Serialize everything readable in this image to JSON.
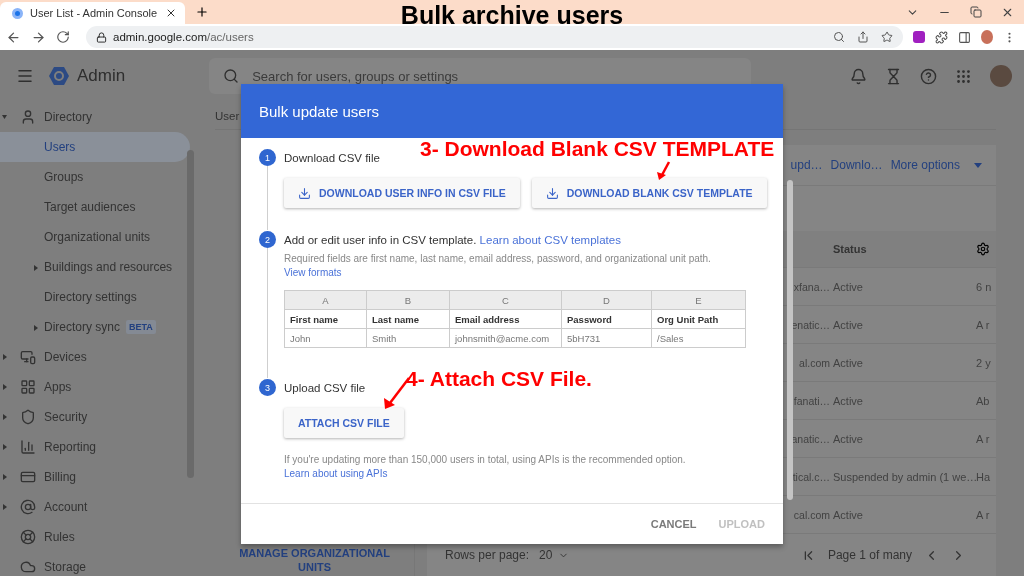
{
  "annotation_title": "Bulk archive users",
  "browser": {
    "tab_title": "User List - Admin Console",
    "url_host": "admin.google.com",
    "url_path": "/ac/users"
  },
  "header": {
    "app_name": "Admin",
    "search": {
      "placeholder": "Search for users, groups or settings"
    }
  },
  "sidebar": {
    "items": [
      {
        "label": "Directory",
        "kind": "folder",
        "expanded": true,
        "selected": false,
        "children": [
          {
            "label": "Users",
            "kind": "leaf",
            "selected": true
          },
          {
            "label": "Groups",
            "kind": "leaf",
            "selected": false
          },
          {
            "label": "Target audiences",
            "kind": "leaf",
            "selected": false
          },
          {
            "label": "Organizational units",
            "kind": "leaf",
            "selected": false
          },
          {
            "label": "Buildings and resources",
            "kind": "folder",
            "expanded": false,
            "selected": false
          },
          {
            "label": "Directory settings",
            "kind": "leaf",
            "selected": false
          },
          {
            "label": "Directory sync",
            "kind": "folder",
            "expanded": false,
            "selected": false,
            "badge": "BETA"
          }
        ]
      },
      {
        "label": "Devices",
        "kind": "folder",
        "expanded": false,
        "selected": false
      },
      {
        "label": "Apps",
        "kind": "folder",
        "expanded": false,
        "selected": false
      },
      {
        "label": "Security",
        "kind": "folder",
        "expanded": false,
        "selected": false
      },
      {
        "label": "Reporting",
        "kind": "folder",
        "expanded": false,
        "selected": false
      },
      {
        "label": "Billing",
        "kind": "folder",
        "expanded": false,
        "selected": false
      },
      {
        "label": "Account",
        "kind": "folder",
        "expanded": false,
        "selected": false
      },
      {
        "label": "Rules",
        "kind": "leaf",
        "selected": false
      },
      {
        "label": "Storage",
        "kind": "leaf",
        "selected": false
      }
    ]
  },
  "main": {
    "tab_label": "User",
    "toolbar": [
      {
        "label": "upd…",
        "kind": "link"
      },
      {
        "label": "Downlo…",
        "kind": "link"
      },
      {
        "label": "More options",
        "kind": "menu"
      }
    ],
    "table": {
      "columns": [
        "Status"
      ],
      "rows": [
        {
          "column_1": "xfana…",
          "status": "Active",
          "column_3": "6 n"
        },
        {
          "column_1": "enatic…",
          "status": "Active",
          "column_3": "A r"
        },
        {
          "column_1": "al.com",
          "status": "Active",
          "column_3": "2 y"
        },
        {
          "column_1": "fanati…",
          "status": "Active",
          "column_3": "Ab"
        },
        {
          "column_1": "anatic…",
          "status": "Active",
          "column_3": "A r"
        },
        {
          "column_1": "tical.c…",
          "status": "Suspended by admin (1 we…",
          "column_3": "Ha"
        },
        {
          "column_1": "cal.com",
          "status": "Active",
          "column_3": "A r"
        }
      ]
    },
    "manage_button": "MANAGE ORGANIZATIONAL UNITS",
    "pager": {
      "rows_label": "Rows per page:",
      "rows_value": "20",
      "page_label": "Page 1 of many"
    }
  },
  "dialog": {
    "title": "Bulk update users",
    "steps": [
      {
        "number": "1",
        "title": "Download CSV file",
        "buttons": [
          "DOWNLOAD USER INFO IN CSV FILE",
          "DOWNLOAD BLANK CSV TEMPLATE"
        ]
      },
      {
        "number": "2",
        "title": "Add or edit user info in CSV template.",
        "link": "Learn about CSV templates",
        "note": "Required fields are first name, last name, email address, password, and organizational unit path.",
        "note_link": "View formats",
        "template": {
          "letters": [
            "A",
            "B",
            "C",
            "D",
            "E"
          ],
          "header": [
            "First name",
            "Last name",
            "Email address",
            "Password",
            "Org Unit Path"
          ],
          "sample": [
            "John",
            "Smith",
            "johnsmith@acme.com",
            "5bH731",
            "/Sales"
          ]
        }
      },
      {
        "number": "3",
        "title": "Upload CSV file",
        "buttons": [
          "ATTACH CSV FILE"
        ],
        "note": "If you're updating more than 150,000 users in total, using APIs is the recommended option.",
        "note_link": "Learn about using APIs"
      }
    ],
    "actions": [
      {
        "label": "CANCEL",
        "disabled": false
      },
      {
        "label": "UPLOAD",
        "disabled": true
      }
    ]
  },
  "annotations": [
    {
      "text": "3- Download Blank CSV TEMPLATE"
    },
    {
      "text": "4- Attach CSV File."
    }
  ]
}
